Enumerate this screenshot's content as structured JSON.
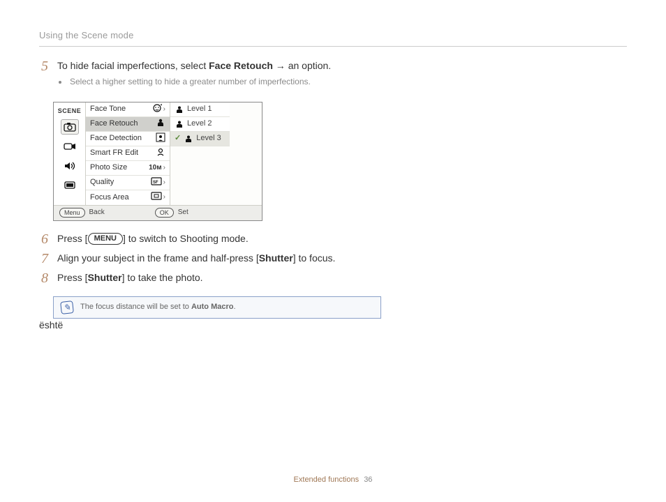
{
  "section_title": "Using the Scene mode",
  "steps": {
    "s5": {
      "num": "5",
      "pre": "To hide facial imperfections, select ",
      "bold": "Face Retouch",
      "arrow": " → ",
      "post": "an option.",
      "bullet1": "Select a higher setting to hide a greater number of imperfections."
    },
    "s6": {
      "num": "6",
      "pre": "Press [",
      "menu_pill": "MENU",
      "post": "] to switch to Shooting mode."
    },
    "s7": {
      "num": "7",
      "pre": "Align your subject in the frame and half-press [",
      "bold": "Shutter",
      "post": "] to focus."
    },
    "s8": {
      "num": "8",
      "pre": "Press [",
      "bold": "Shutter",
      "post": "] to take the photo."
    }
  },
  "mock": {
    "scene_label": "SCENE",
    "left_icons": [
      "camera-icon",
      "video-icon",
      "sound-icon",
      "display-icon"
    ],
    "menu": {
      "items": [
        {
          "label": "Face Tone",
          "icon": "face-tone-icon",
          "chev": true
        },
        {
          "label": "Face Retouch",
          "icon": "face-retouch-icon",
          "selected": true
        },
        {
          "label": "Face Detection",
          "icon": "face-detect-icon"
        },
        {
          "label": "Smart FR Edit",
          "icon": "smart-fr-icon"
        },
        {
          "label": "Photo Size",
          "icon": "photo-size-icon",
          "text_icon": "10м",
          "chev": true
        },
        {
          "label": "Quality",
          "icon": "quality-icon",
          "chev": true
        },
        {
          "label": "Focus Area",
          "icon": "focus-area-icon",
          "chev": true
        }
      ]
    },
    "levels": [
      {
        "label": "Level 1"
      },
      {
        "label": "Level 2"
      },
      {
        "label": "Level 3",
        "selected": true,
        "tick": "✓"
      }
    ],
    "footer": {
      "menu_pill": "Menu",
      "back_label": "Back",
      "ok_pill": "OK",
      "set_label": "Set"
    }
  },
  "note": {
    "text_pre": "The focus distance will be set to ",
    "bold": "Auto Macro",
    "text_post": "."
  },
  "footer": {
    "label": "Extended functions",
    "page": "36"
  }
}
